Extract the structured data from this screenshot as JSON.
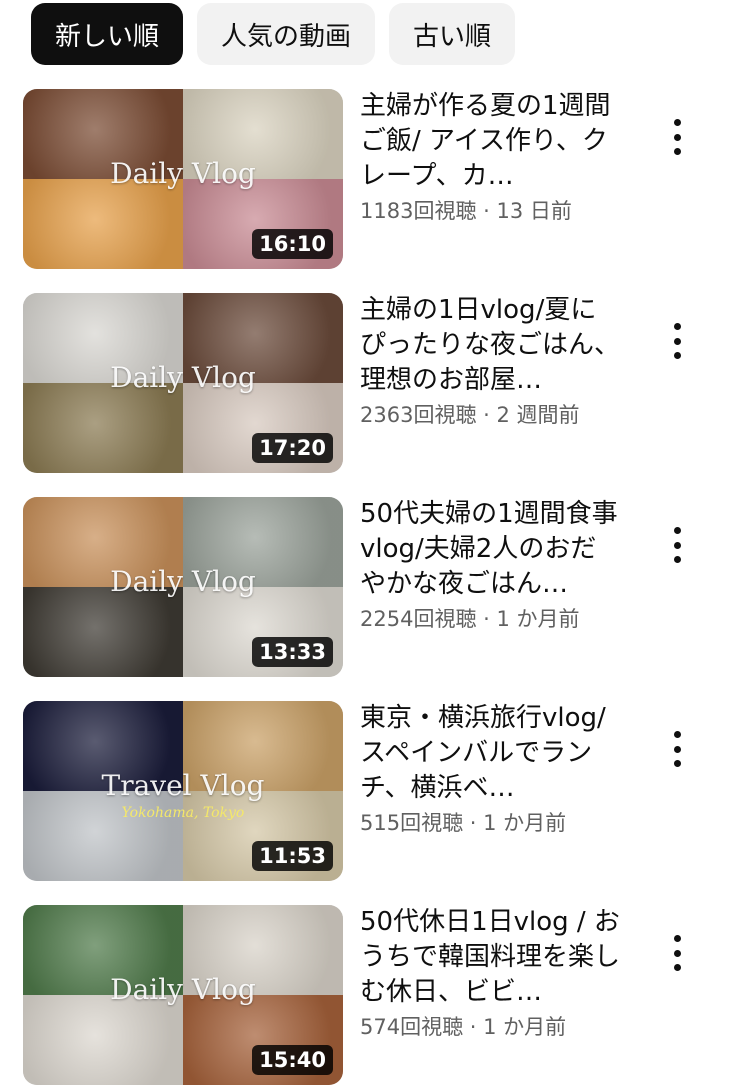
{
  "chips": [
    {
      "label": "新しい順",
      "active": true
    },
    {
      "label": "人気の動画",
      "active": false
    },
    {
      "label": "古い順",
      "active": false
    }
  ],
  "videos": [
    {
      "title": "主婦が作る夏の1週間ご飯/ アイス作り、クレープ、カ…",
      "views": "1183回視聴",
      "age": "13 日前",
      "duration": "16:10",
      "thumb_title": "Daily Vlog",
      "thumb_sub": "",
      "colors": [
        "#7a4b33",
        "#d9d2bf",
        "#e6a04a",
        "#c88a93"
      ]
    },
    {
      "title": "主婦の1日vlog/夏にぴったりな夜ごはん、理想のお部屋…",
      "views": "2363回視聴",
      "age": "2 週間前",
      "duration": "17:20",
      "thumb_title": "Daily Vlog",
      "thumb_sub": "",
      "colors": [
        "#d8d6d1",
        "#6a4a3a",
        "#8a7a52",
        "#d7c9bf"
      ]
    },
    {
      "title": "50代夫婦の1週間食事vlog/夫婦2人のおだやかな夜ごはん…",
      "views": "2254回視聴",
      "age": "1 か月前",
      "duration": "13:33",
      "thumb_title": "Daily Vlog",
      "thumb_sub": "",
      "colors": [
        "#c8905a",
        "#9aa29a",
        "#3e3a33",
        "#dcd8d0"
      ]
    },
    {
      "title": "東京・横浜旅行vlog/スペインバルでランチ、横浜ベ…",
      "views": "515回視聴",
      "age": "1 か月前",
      "duration": "11:53",
      "thumb_title": "Travel Vlog",
      "thumb_sub": "Yokohama, Tokyo",
      "colors": [
        "#1a1c3a",
        "#c9a066",
        "#bfc3c7",
        "#d4c7a6"
      ]
    },
    {
      "title": "50代休日1日vlog / おうちで韓国料理を楽しむ休日、ビビ…",
      "views": "574回視聴",
      "age": "1 か月前",
      "duration": "15:40",
      "thumb_title": "Daily Vlog",
      "thumb_sub": "",
      "colors": [
        "#4f7a4a",
        "#d8d2c8",
        "#dcd7cf",
        "#a5613a"
      ]
    }
  ]
}
